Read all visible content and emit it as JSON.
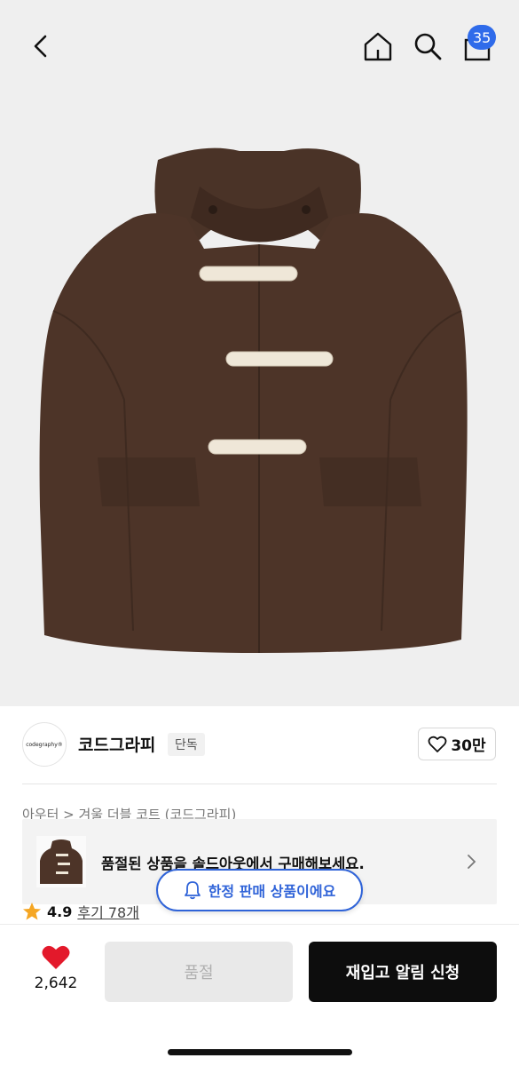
{
  "header": {
    "cart_count": "35",
    "icons": [
      "back-chevron-icon",
      "home-icon",
      "search-icon",
      "cart-icon"
    ],
    "accent_color": "#2f6bea"
  },
  "product": {
    "image": "brown-duffle-coat",
    "category": "아우터 > 겨울 더블 코트 (코드그라피)"
  },
  "brand": {
    "logo_text": "codegraphy®",
    "name": "코드그라피",
    "tag": "단독",
    "likes": "30만"
  },
  "soldout_banner": {
    "text": "품절된 상품을 솔드아웃에서 구매해보세요."
  },
  "notice": {
    "text": "한정 판매 상품이에요",
    "color": "#2f63d8"
  },
  "rating": {
    "score": "4.9",
    "reviews": "후기 78개"
  },
  "bottom_bar": {
    "wish_count": "2,642",
    "soldout_label": "품절",
    "restock_label": "재입고 알림 신청",
    "heart_color": "#e3192b"
  }
}
